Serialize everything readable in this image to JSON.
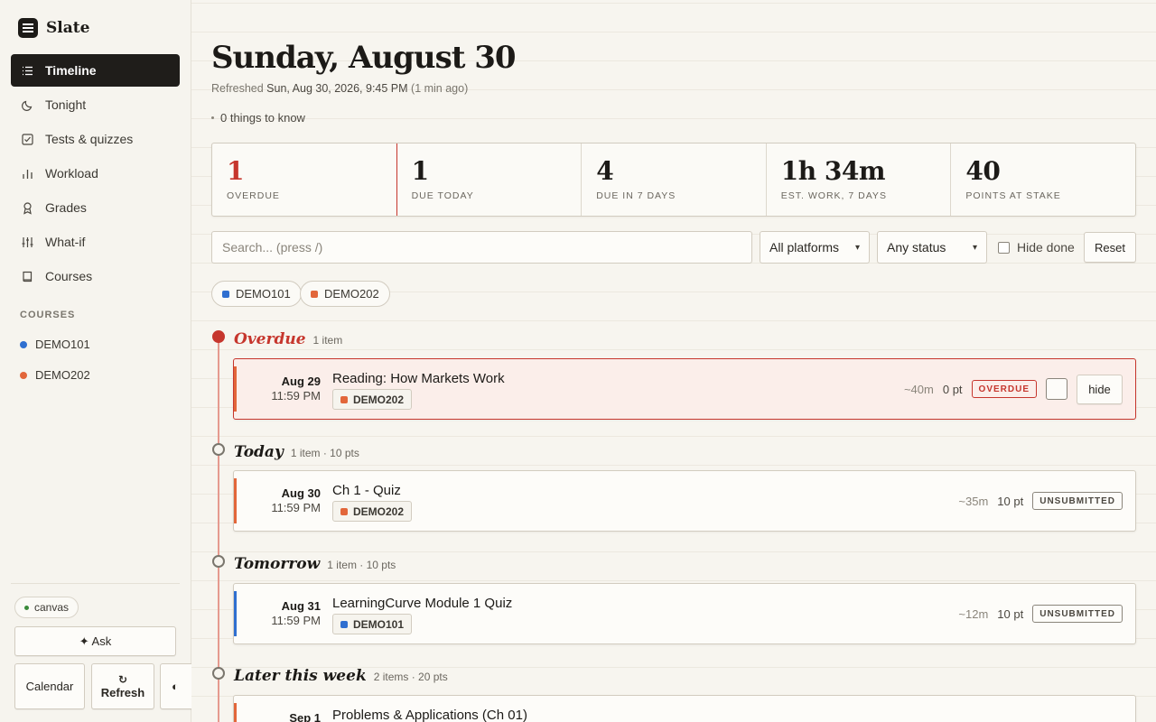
{
  "app": {
    "name": "Slate"
  },
  "sidebar": {
    "items": [
      {
        "label": "Timeline",
        "icon": "list-icon",
        "active": true
      },
      {
        "label": "Tonight",
        "icon": "moon-icon"
      },
      {
        "label": "Tests & quizzes",
        "icon": "checkbox-icon"
      },
      {
        "label": "Workload",
        "icon": "bar-chart-icon"
      },
      {
        "label": "Grades",
        "icon": "ribbon-icon"
      },
      {
        "label": "What-if",
        "icon": "sliders-icon"
      },
      {
        "label": "Courses",
        "icon": "book-icon"
      }
    ],
    "courses_heading": "COURSES",
    "courses": [
      {
        "label": "DEMO101",
        "color": "#2f6fd0"
      },
      {
        "label": "DEMO202",
        "color": "#e2663a"
      }
    ],
    "source_pill": "canvas",
    "ask_label": "✦ Ask",
    "calendar_label": "Calendar",
    "refresh_icon": "↻",
    "refresh_label": "Refresh",
    "theme_icon": "◐"
  },
  "header": {
    "title": "Sunday, August 30",
    "refreshed_prefix": "Refreshed",
    "refreshed_time": "Sun, Aug 30, 2026, 9:45 PM",
    "refreshed_ago": "(1 min ago)",
    "things_to_know": "0 things to know"
  },
  "stats": [
    {
      "value": "1",
      "label": "OVERDUE"
    },
    {
      "value": "1",
      "label": "DUE TODAY"
    },
    {
      "value": "4",
      "label": "DUE IN 7 DAYS"
    },
    {
      "value": "1h 34m",
      "label": "EST. WORK, 7 DAYS"
    },
    {
      "value": "40",
      "label": "POINTS AT STAKE"
    }
  ],
  "filters": {
    "search_placeholder": "Search...  (press /)",
    "platform": "All platforms",
    "status": "Any status",
    "hide_done": "Hide done",
    "reset": "Reset"
  },
  "chips": [
    {
      "label": "DEMO101",
      "color": "#2f6fd0"
    },
    {
      "label": "DEMO202",
      "color": "#e2663a"
    }
  ],
  "groups": [
    {
      "title": "Overdue",
      "meta": "1 item",
      "items": [
        {
          "date": "Aug 29",
          "time": "11:59 PM",
          "title": "Reading: How Markets Work",
          "course": "DEMO202",
          "course_color": "#e2663a",
          "est": "~40m",
          "pts": "0 pt",
          "status": "OVERDUE",
          "hide": "hide"
        }
      ]
    },
    {
      "title": "Today",
      "meta": "1 item · 10 pts",
      "items": [
        {
          "date": "Aug 30",
          "time": "11:59 PM",
          "title": "Ch 1 - Quiz",
          "course": "DEMO202",
          "course_color": "#e2663a",
          "est": "~35m",
          "pts": "10 pt",
          "status": "UNSUBMITTED"
        }
      ]
    },
    {
      "title": "Tomorrow",
      "meta": "1 item · 10 pts",
      "items": [
        {
          "date": "Aug 31",
          "time": "11:59 PM",
          "title": "LearningCurve Module 1 Quiz",
          "course": "DEMO101",
          "course_color": "#2f6fd0",
          "est": "~12m",
          "pts": "10 pt",
          "status": "UNSUBMITTED"
        }
      ]
    },
    {
      "title": "Later this week",
      "meta": "2 items · 20 pts",
      "items": [
        {
          "date": "Sep 1",
          "title": "Problems & Applications (Ch 01)",
          "course_color": "#e2663a"
        }
      ]
    }
  ]
}
